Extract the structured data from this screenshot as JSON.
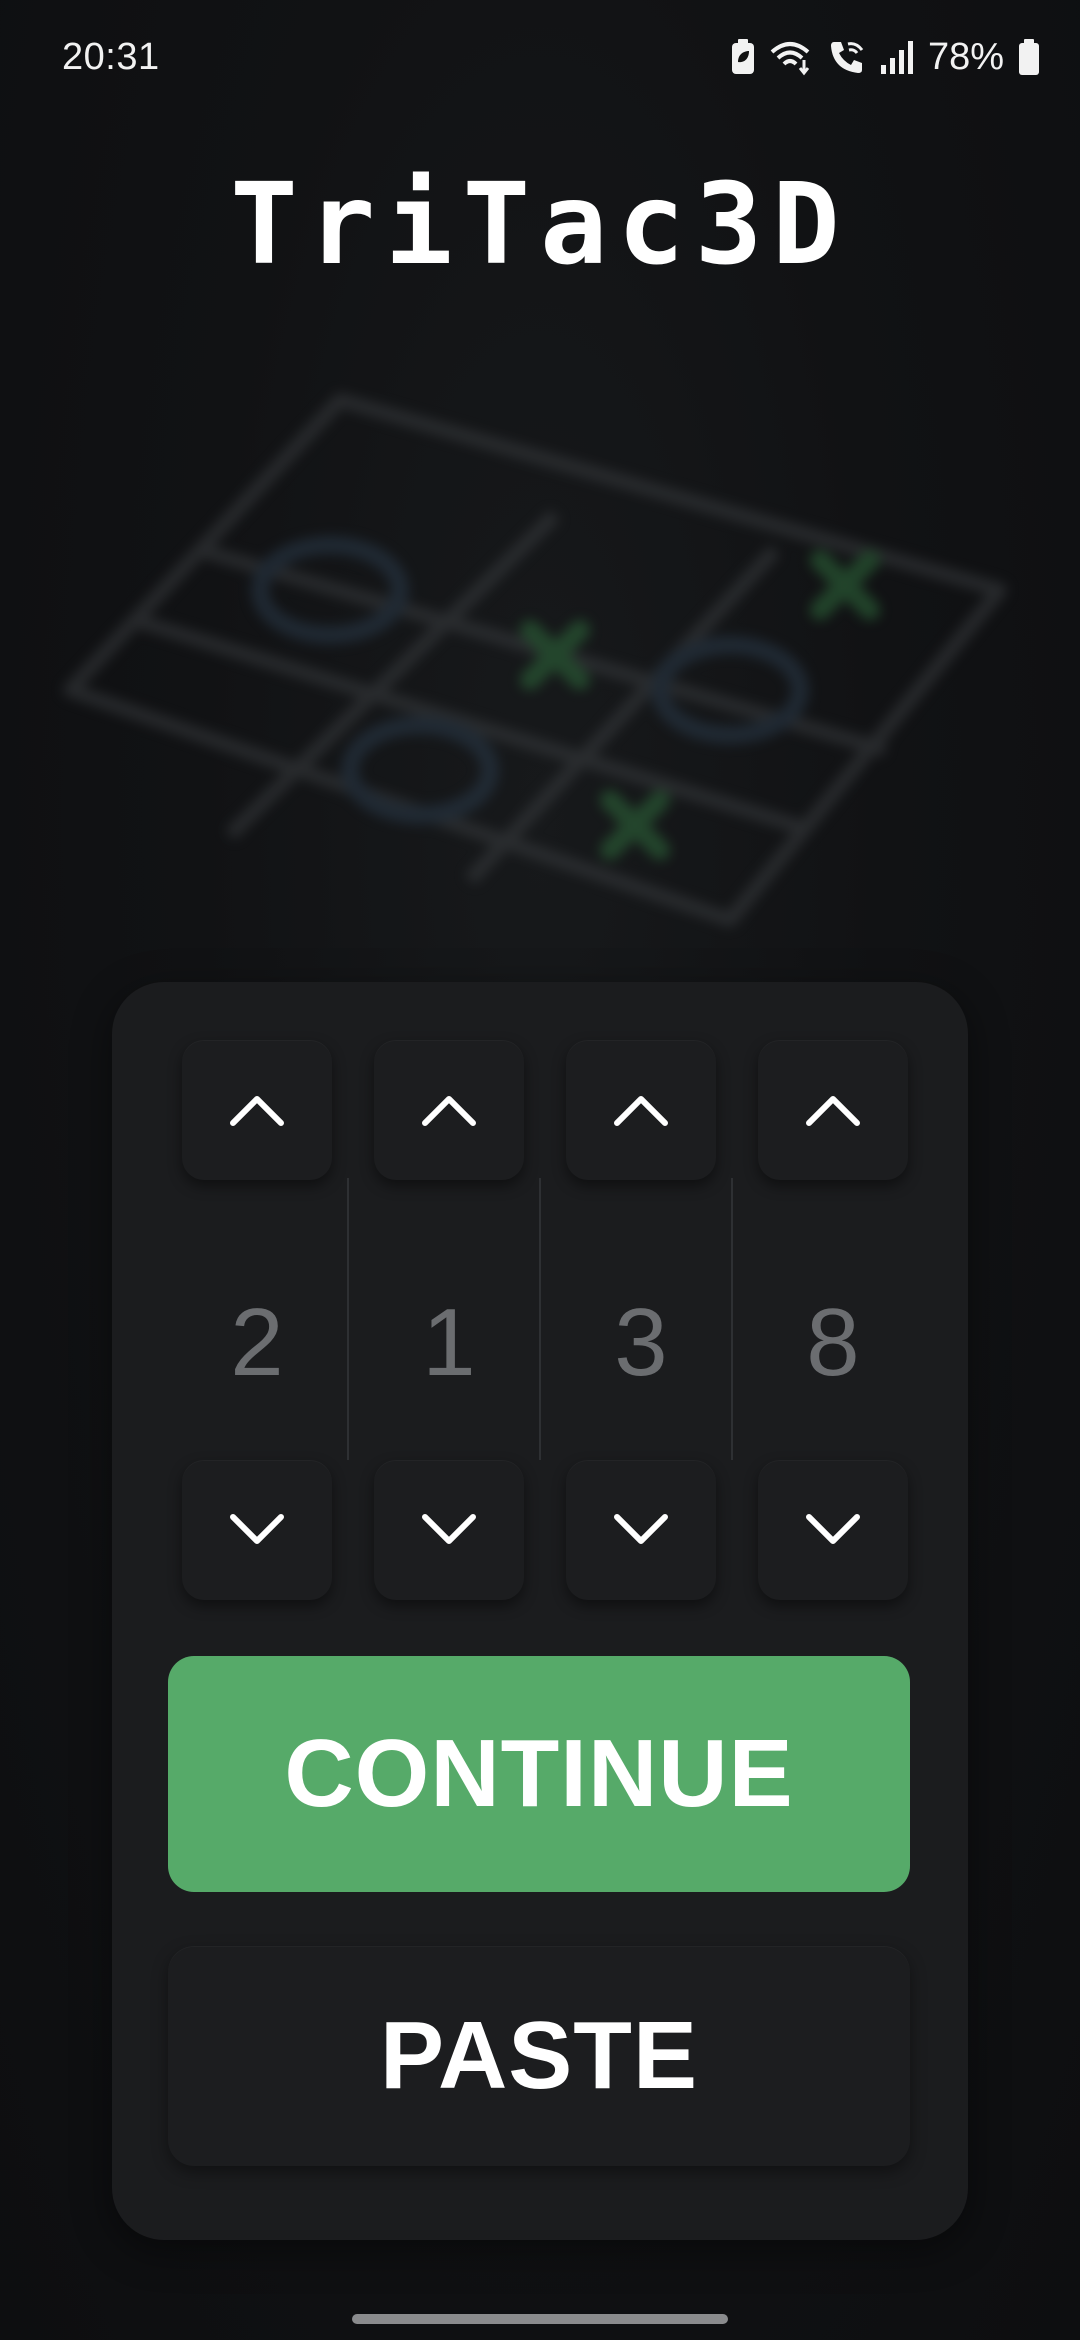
{
  "status_bar": {
    "time": "20:31",
    "battery_percent": "78%",
    "icons": [
      "battery-saver-icon",
      "wifi-calling-icon",
      "call-wifi-icon",
      "signal-icon",
      "battery-icon"
    ]
  },
  "app": {
    "title": "TriTac3D"
  },
  "code_picker": {
    "digits": [
      {
        "value": "2"
      },
      {
        "value": "1"
      },
      {
        "value": "3"
      },
      {
        "value": "8"
      }
    ],
    "up_icon": "chevron-up-icon",
    "down_icon": "chevron-down-icon"
  },
  "actions": {
    "continue_label": "CONTINUE",
    "paste_label": "PASTE"
  },
  "colors": {
    "accent_green": "#56aa69",
    "panel": "#1b1c1e",
    "digit_text": "#6b6d70"
  }
}
